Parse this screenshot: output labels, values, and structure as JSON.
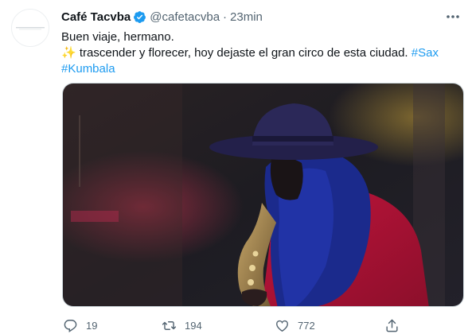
{
  "tweet": {
    "author_name": "Café Tacvba",
    "handle": "@cafetacvba",
    "separator": "·",
    "time": "23min",
    "line1": "Buen viaje, hermano.",
    "line2_emoji": "✨",
    "line2_text": " trascender y florecer, hoy dejaste el gran circo de esta ciudad. ",
    "hashtag1": "#Sax",
    "hashtag2": "#Kumbala",
    "reply_count": "19",
    "retweet_count": "194",
    "like_count": "772"
  },
  "icons": {
    "verified": "verified-badge-icon",
    "more": "more-dots-icon",
    "reply": "reply-icon",
    "retweet": "retweet-icon",
    "like": "heart-icon",
    "share": "share-icon"
  },
  "colors": {
    "link": "#1d9bf0",
    "secondary_text": "#536471",
    "primary_text": "#0f1419"
  }
}
